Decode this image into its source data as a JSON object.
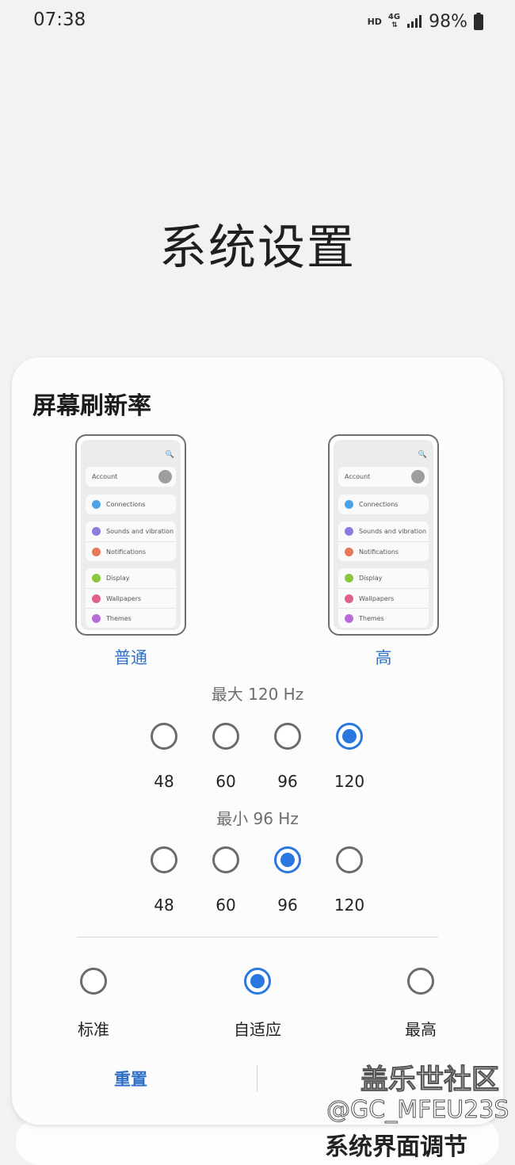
{
  "status_bar": {
    "time": "07:38",
    "hd": "HD",
    "network": "4G",
    "battery": "98%"
  },
  "page_title": "系统设置",
  "background_text": "系统界面调节",
  "dialog": {
    "title": "屏幕刷新率",
    "previews": [
      {
        "label": "普通",
        "rows": {
          "account": "Account",
          "connections": "Connections",
          "sounds": "Sounds and vibration",
          "notifications": "Notifications",
          "display": "Display",
          "wallpapers": "Wallpapers",
          "themes": "Themes"
        }
      },
      {
        "label": "高",
        "rows": {
          "account": "Account",
          "connections": "Connections",
          "sounds": "Sounds and vibration",
          "notifications": "Notifications",
          "display": "Display",
          "wallpapers": "Wallpapers",
          "themes": "Themes"
        }
      }
    ],
    "max_label": "最大 120 Hz",
    "max_options": [
      "48",
      "60",
      "96",
      "120"
    ],
    "max_selected": "120",
    "min_label": "最小 96 Hz",
    "min_options": [
      "48",
      "60",
      "96",
      "120"
    ],
    "min_selected": "96",
    "modes": [
      "标准",
      "自适应",
      "最高"
    ],
    "mode_selected": "自适应",
    "reset_label": "重置"
  },
  "watermark": {
    "line1": "盖乐世社区",
    "line2": "@GC_MFEU23S"
  },
  "colors": {
    "accent": "#2a77e0",
    "link": "#2f6fc8",
    "background": "#f2f2f2"
  }
}
